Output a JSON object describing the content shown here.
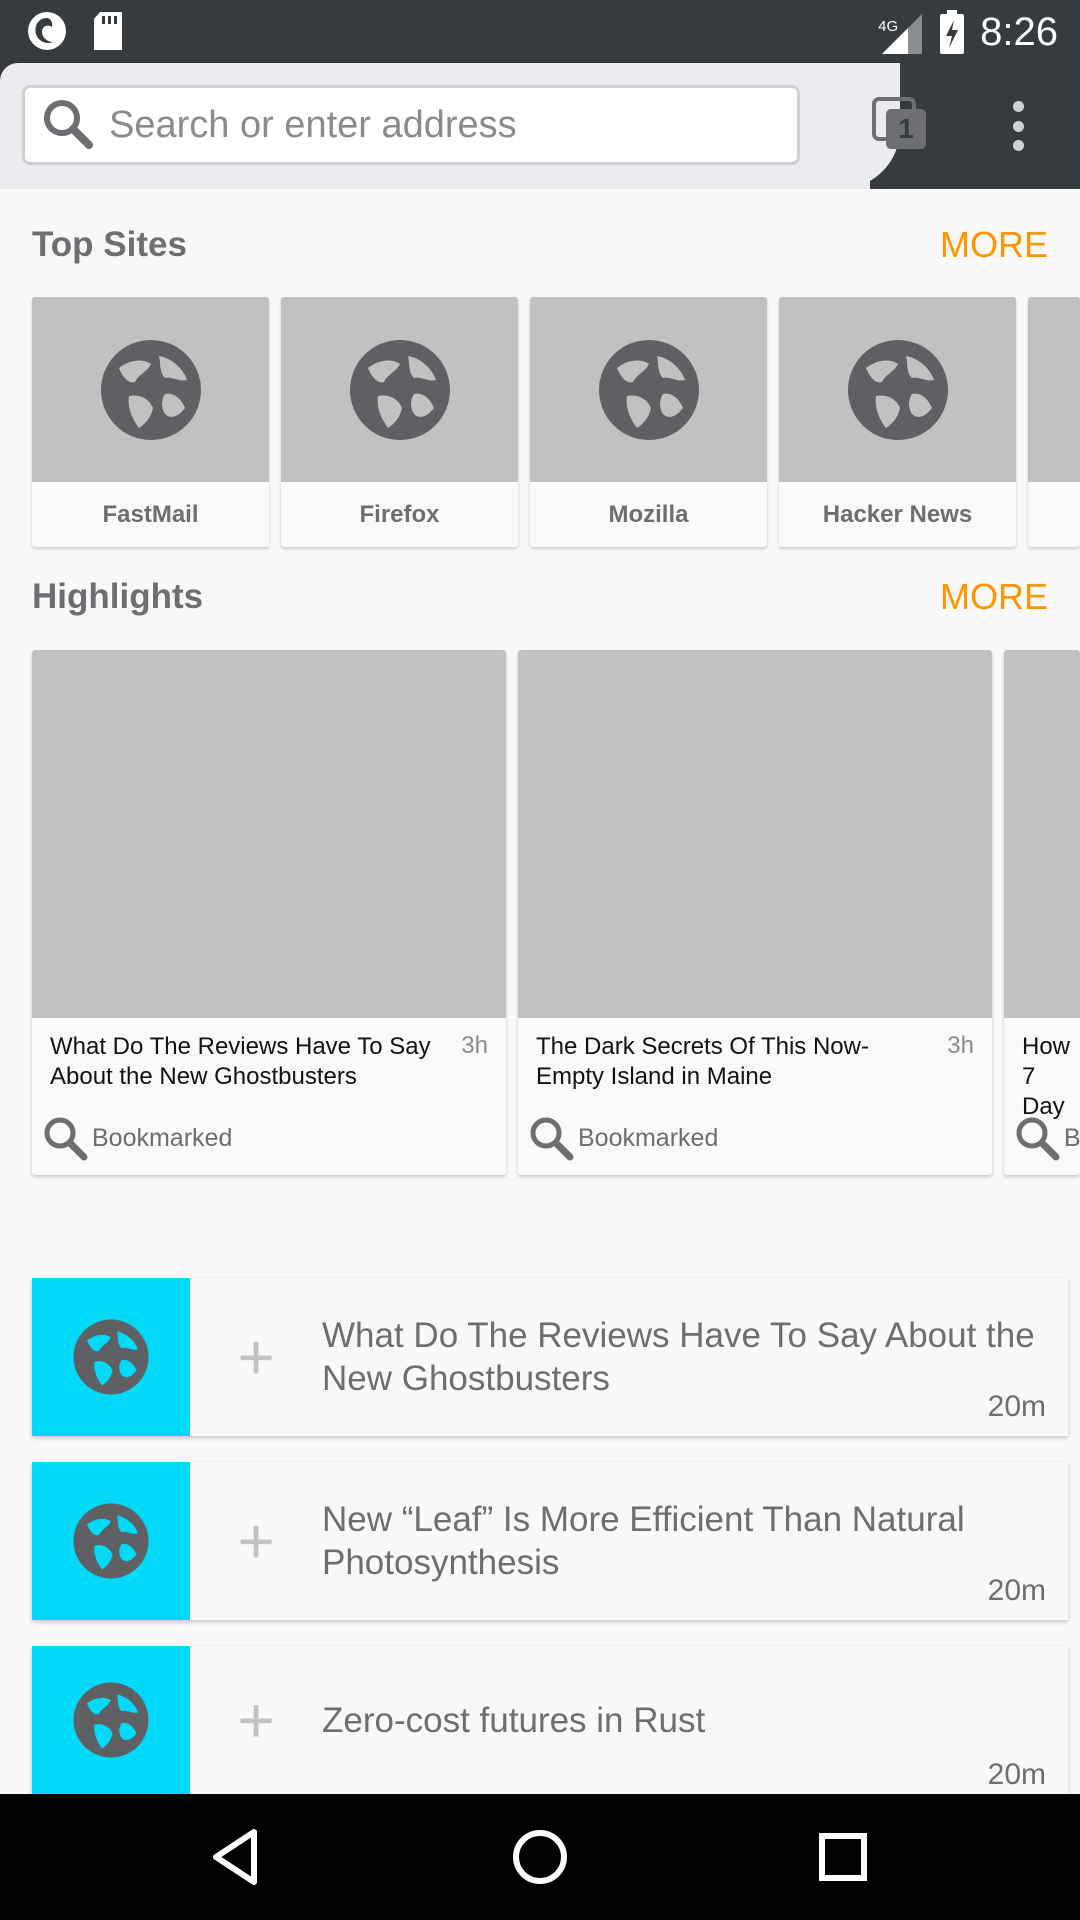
{
  "status_bar": {
    "time": "8:26",
    "network": "4G"
  },
  "toolbar": {
    "search_placeholder": "Search or enter address",
    "tab_count": "1"
  },
  "top_sites": {
    "title": "Top Sites",
    "more": "MORE",
    "items": [
      {
        "label": "FastMail"
      },
      {
        "label": "Firefox"
      },
      {
        "label": "Mozilla"
      },
      {
        "label": "Hacker News"
      }
    ]
  },
  "highlights": {
    "title": "Highlights",
    "more": "MORE",
    "items": [
      {
        "title": "What Do The Reviews Have To Say About the New Ghostbusters",
        "time": "3h",
        "source": "Bookmarked"
      },
      {
        "title": "The Dark Secrets Of This Now-Empty Island in Maine",
        "time": "3h",
        "source": "Bookmarked"
      },
      {
        "title": "How 7 Day",
        "time": "",
        "source": "Bo"
      }
    ]
  },
  "stories": [
    {
      "title": "What Do The Reviews Have To Say About the New Ghostbusters",
      "time": "20m"
    },
    {
      "title": "New “Leaf” Is More Efficient Than Natural Photosynthesis",
      "time": "20m"
    },
    {
      "title": "Zero-cost futures in Rust",
      "time": "20m"
    }
  ],
  "colors": {
    "accent": "#ff9500",
    "toolbar": "#363b40",
    "story_favicon_bg": "#00d9f7"
  }
}
